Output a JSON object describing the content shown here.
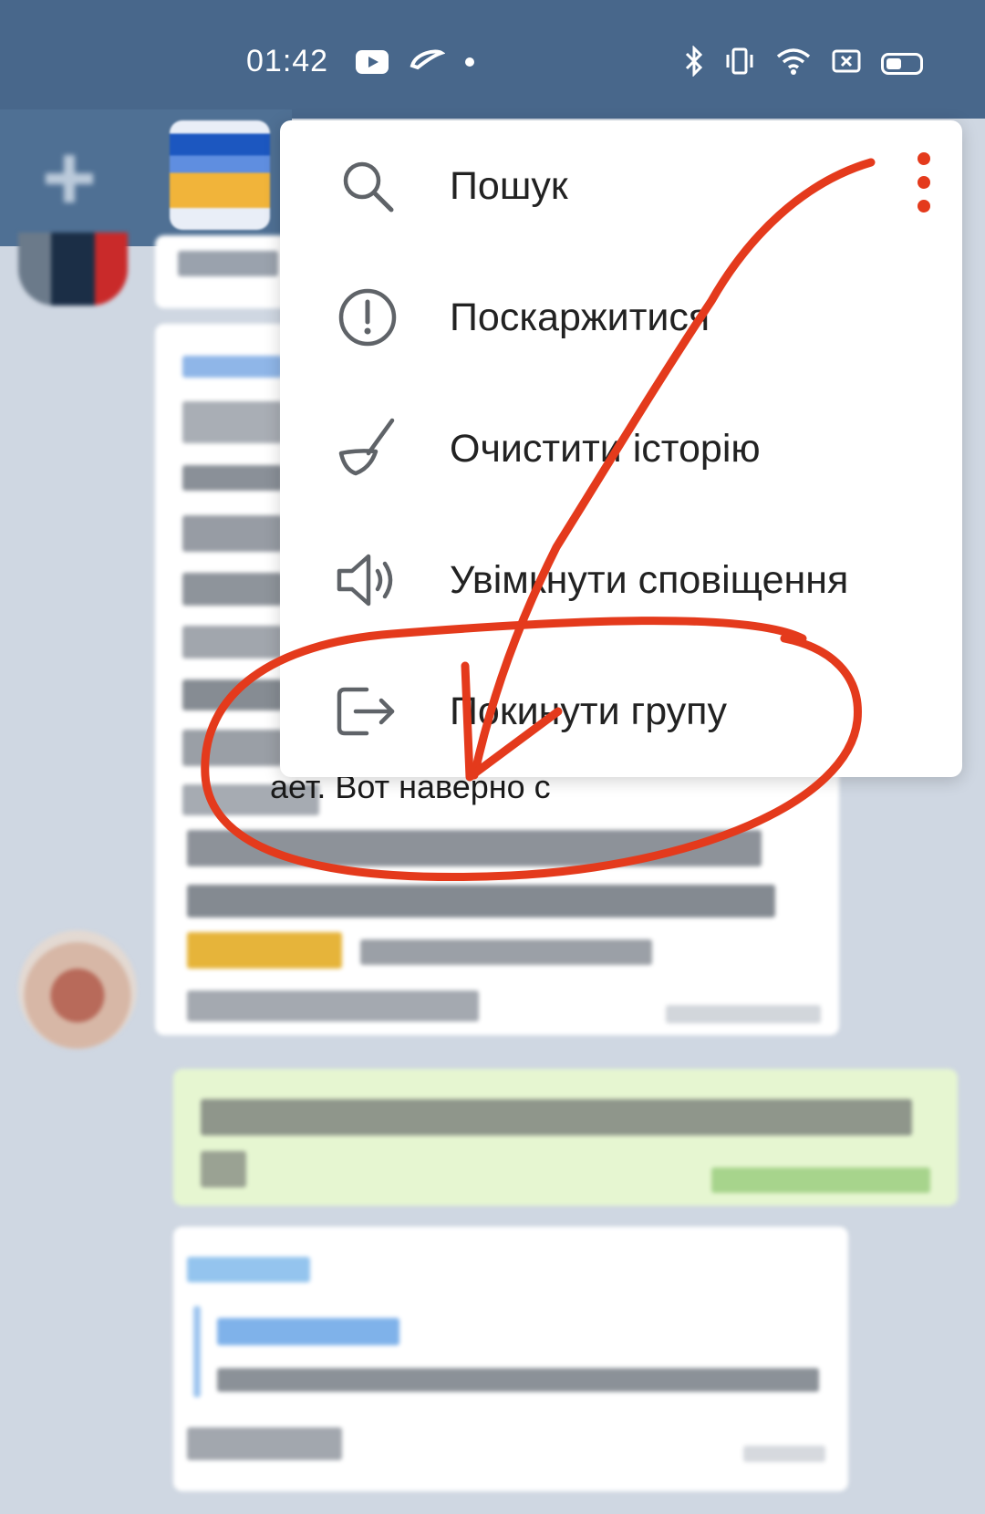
{
  "status_bar": {
    "time": "01:42",
    "left_icons": [
      "youtube-icon",
      "cloud-icon",
      "dot-icon"
    ],
    "right_icons": [
      "bluetooth-icon",
      "vibrate-icon",
      "wifi-icon",
      "sim-icon",
      "battery-icon"
    ]
  },
  "menu": {
    "items": [
      {
        "label": "Пошук",
        "icon": "search-icon"
      },
      {
        "label": "Поскаржитися",
        "icon": "report-icon"
      },
      {
        "label": "Очистити історію",
        "icon": "broom-icon"
      },
      {
        "label": "Увімкнути сповіщення",
        "icon": "speaker-icon"
      },
      {
        "label": "Покинути групу",
        "icon": "leave-icon"
      }
    ]
  },
  "chat": {
    "visible_text_fragment": "ает. Вот наверно с"
  },
  "annotation": {
    "color": "#e43a1c"
  }
}
